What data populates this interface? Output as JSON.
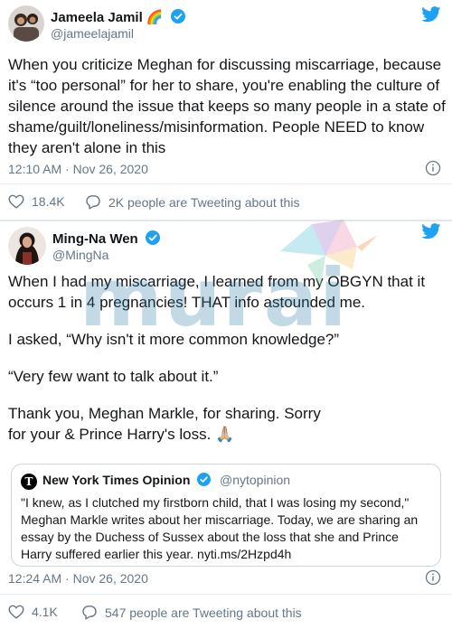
{
  "tweet1": {
    "name": "Jameela Jamil",
    "name_emoji": "🌈",
    "handle": "@jameelajamil",
    "text": "When you criticize Meghan for discussing miscarriage, because it's “too personal” for her to share, you're enabling the culture of silence around the issue that keeps so many people in a state of shame/guilt/loneliness/misinformation. People NEED to know they aren't alone in this",
    "timestamp": "12:10 AM · Nov 26, 2020",
    "likes": "18.4K",
    "tweeting": "2K people are Tweeting about this"
  },
  "tweet2": {
    "name": "Ming-Na Wen",
    "handle": "@MingNa",
    "paragraphs": [
      "When I had my miscarriage, I learned from my OBGYN that it occurs 1 in 4 pregnancies! THAT info astounded me.",
      "I asked, “Why isn't it more common knowledge?”",
      "“Very few want to talk about it.”",
      "Thank you, Meghan Markle, for sharing. Sorry for your & Prince Harry's loss. 🙏🏼"
    ],
    "timestamp": "12:24 AM · Nov 26, 2020",
    "likes": "4.1K",
    "tweeting": "547 people are Tweeting about this"
  },
  "quote": {
    "logo": "T",
    "name": "New York Times Opinion",
    "handle": "@nytopinion",
    "text": "\"I knew, as I clutched my firstborn child, that I was losing my second,\" Meghan Markle writes about her miscarriage. Today, we are sharing an essay by the Duchess of Sussex about the loss that she and Prince Harry suffered earlier this year. nyti.ms/2Hzpd4h"
  },
  "watermark": {
    "text": "murai"
  },
  "colors": {
    "twitter_blue": "#1da1f2",
    "text": "#14171a",
    "muted": "#657786",
    "divider": "#e6ecf0"
  }
}
